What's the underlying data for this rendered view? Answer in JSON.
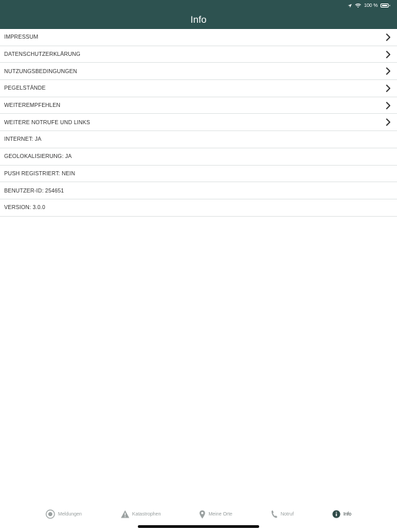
{
  "status": {
    "battery": "100 %"
  },
  "header": {
    "title": "Info"
  },
  "rows": [
    {
      "label": "IMPRESSUM",
      "chevron": true
    },
    {
      "label": "DATENSCHUTZERKLÄRUNG",
      "chevron": true
    },
    {
      "label": "NUTZUNGSBEDINGUNGEN",
      "chevron": true
    },
    {
      "label": "PEGELSTÄNDE",
      "chevron": true
    },
    {
      "label": "WEITEREMPFEHLEN",
      "chevron": true
    },
    {
      "label": "WEITERE NOTRUFE UND LINKS",
      "chevron": true
    },
    {
      "label": "INTERNET: JA",
      "chevron": false
    },
    {
      "label": "GEOLOKALISIERUNG: JA",
      "chevron": false
    },
    {
      "label": "PUSH REGISTRIERT: NEIN",
      "chevron": false
    },
    {
      "label": "BENUTZER-ID: 254651",
      "chevron": false
    },
    {
      "label": "VERSION: 3.0.0",
      "chevron": false
    }
  ],
  "tabs": [
    {
      "label": "Meldungen",
      "icon": "alert-circle-icon"
    },
    {
      "label": "Katastrophen",
      "icon": "warning-triangle-icon"
    },
    {
      "label": "Meine Orte",
      "icon": "location-pin-icon"
    },
    {
      "label": "Notruf",
      "icon": "phone-icon"
    },
    {
      "label": "Info",
      "icon": "info-icon",
      "active": true
    }
  ],
  "colors": {
    "header": "#2d5250",
    "active_tab": "#2f3a3a",
    "inactive_tab": "#9aa0a0"
  }
}
